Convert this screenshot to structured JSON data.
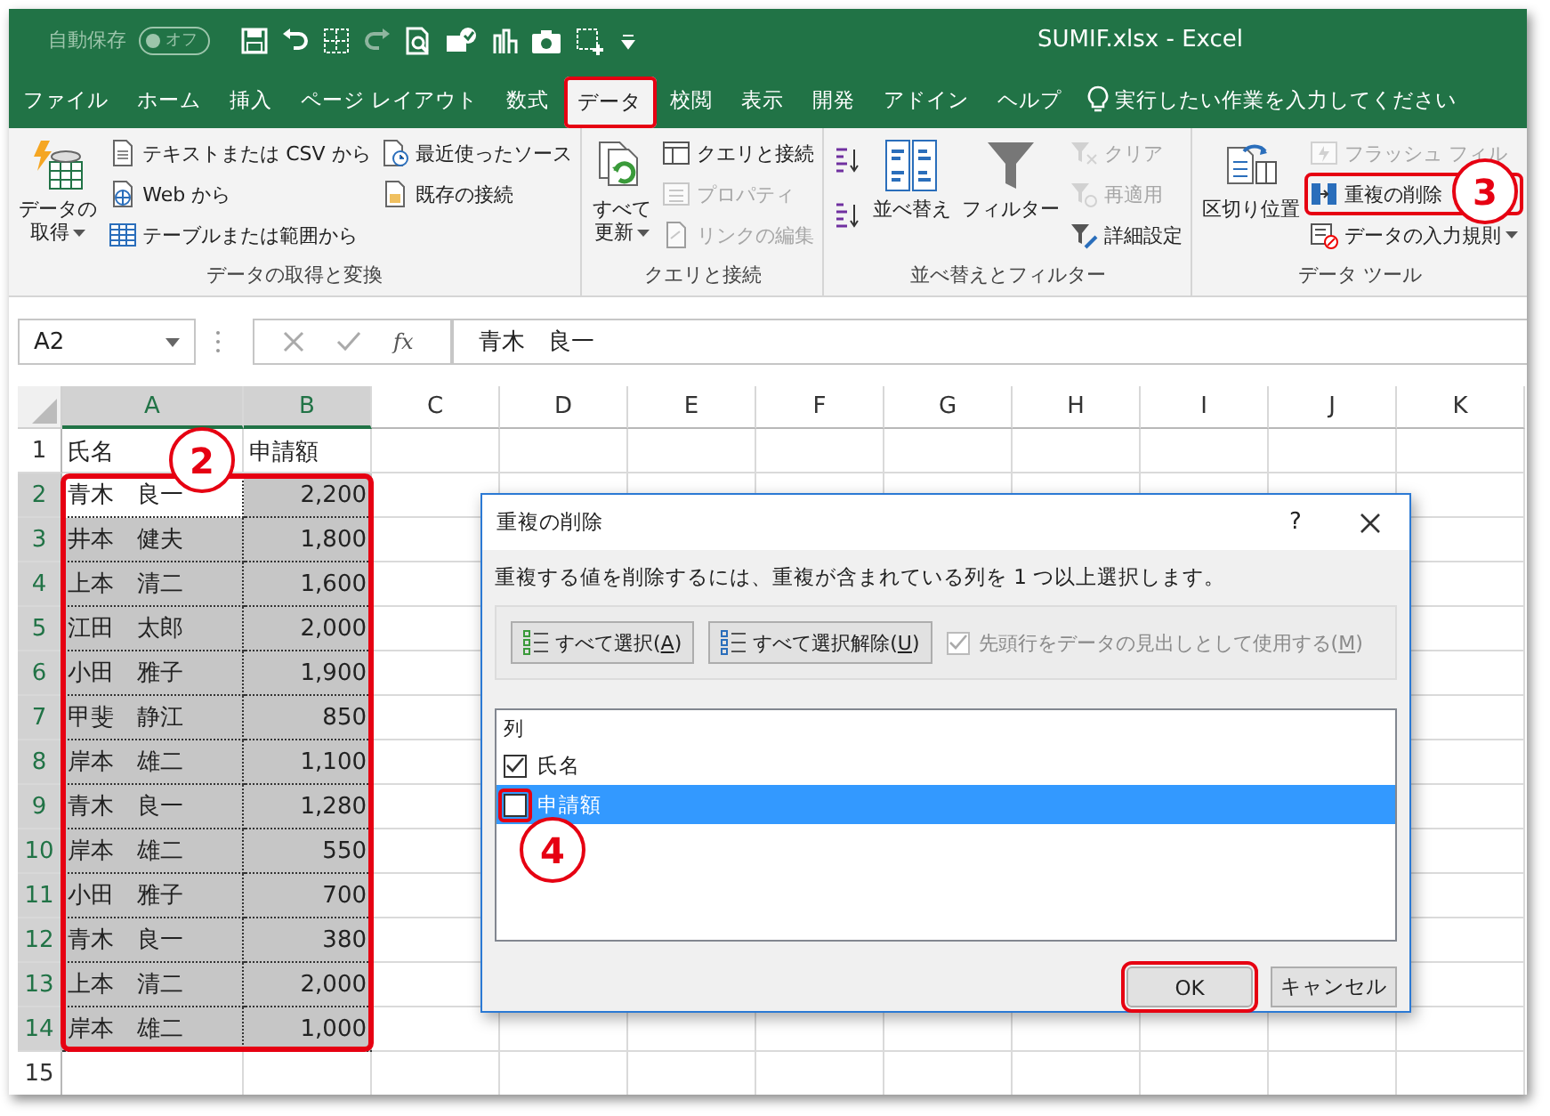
{
  "window": {
    "title": "SUMIF.xlsx - Excel"
  },
  "autosave": {
    "label": "自動保存",
    "state": "オフ",
    "on": false
  },
  "tabs": [
    {
      "label": "ファイル",
      "selected": false,
      "highlighted": false
    },
    {
      "label": "ホーム",
      "selected": false,
      "highlighted": false
    },
    {
      "label": "挿入",
      "selected": false,
      "highlighted": false
    },
    {
      "label": "ページ レイアウト",
      "selected": false,
      "highlighted": false
    },
    {
      "label": "数式",
      "selected": false,
      "highlighted": false
    },
    {
      "label": "データ",
      "selected": true,
      "highlighted": true
    },
    {
      "label": "校閲",
      "selected": false,
      "highlighted": false
    },
    {
      "label": "表示",
      "selected": false,
      "highlighted": false
    },
    {
      "label": "開発",
      "selected": false,
      "highlighted": false
    },
    {
      "label": "アドイン",
      "selected": false,
      "highlighted": false
    },
    {
      "label": "ヘルプ",
      "selected": false,
      "highlighted": false
    }
  ],
  "tell_me": {
    "text": "実行したい作業を入力してください"
  },
  "ribbon": {
    "groups": [
      {
        "label": "データの取得と変換",
        "columns": [
          [
            {
              "kind": "large",
              "label": "データの取得",
              "dropdown": true,
              "disabled": false,
              "highlighted": false
            }
          ],
          [
            {
              "kind": "small",
              "label": "テキストまたは CSV から",
              "dropdown": false,
              "disabled": false,
              "highlighted": false
            },
            {
              "kind": "small",
              "label": "Web から",
              "dropdown": false,
              "disabled": false,
              "highlighted": false
            },
            {
              "kind": "small",
              "label": "テーブルまたは範囲から",
              "dropdown": false,
              "disabled": false,
              "highlighted": false
            }
          ],
          [
            {
              "kind": "small",
              "label": "最近使ったソース",
              "dropdown": false,
              "disabled": false,
              "highlighted": false
            },
            {
              "kind": "small",
              "label": "既存の接続",
              "dropdown": false,
              "disabled": false,
              "highlighted": false
            }
          ]
        ]
      },
      {
        "label": "クエリと接続",
        "columns": [
          [
            {
              "kind": "large",
              "label": "すべて更新",
              "dropdown": true,
              "disabled": false,
              "highlighted": false
            }
          ],
          [
            {
              "kind": "small",
              "label": "クエリと接続",
              "dropdown": false,
              "disabled": false,
              "highlighted": false
            },
            {
              "kind": "small",
              "label": "プロパティ",
              "dropdown": false,
              "disabled": true,
              "highlighted": false
            },
            {
              "kind": "small",
              "label": "リンクの編集",
              "dropdown": false,
              "disabled": true,
              "highlighted": false
            }
          ]
        ]
      },
      {
        "label": "並べ替えとフィルター",
        "columns": [
          [
            {
              "kind": "icon",
              "highlighted": false
            },
            {
              "kind": "icon",
              "highlighted": false
            }
          ],
          [
            {
              "kind": "large",
              "label": "並べ替え",
              "dropdown": false,
              "disabled": false,
              "highlighted": false
            }
          ],
          [
            {
              "kind": "large",
              "label": "フィルター",
              "dropdown": false,
              "disabled": false,
              "highlighted": false
            }
          ],
          [
            {
              "kind": "small",
              "label": "クリア",
              "dropdown": false,
              "disabled": true,
              "highlighted": false
            },
            {
              "kind": "small",
              "label": "再適用",
              "dropdown": false,
              "disabled": true,
              "highlighted": false
            },
            {
              "kind": "small",
              "label": "詳細設定",
              "dropdown": false,
              "disabled": false,
              "highlighted": false
            }
          ]
        ]
      },
      {
        "label": "データ ツール",
        "columns": [
          [
            {
              "kind": "large",
              "label": "区切り位置",
              "dropdown": false,
              "disabled": false,
              "highlighted": false
            }
          ],
          [
            {
              "kind": "small",
              "label": "フラッシュ フィル",
              "dropdown": false,
              "disabled": true,
              "highlighted": false
            },
            {
              "kind": "small",
              "label": "重複の削除",
              "dropdown": false,
              "disabled": false,
              "highlighted": true
            },
            {
              "kind": "small",
              "label": "データの入力規則",
              "dropdown": true,
              "disabled": false,
              "highlighted": false
            }
          ]
        ]
      }
    ]
  },
  "formula_bar": {
    "name_box": "A2",
    "function_label": "fx",
    "value": "青木　良一"
  },
  "grid": {
    "range_highlighted": true,
    "columns": [
      {
        "label": "A",
        "selected": true
      },
      {
        "label": "B",
        "selected": true
      },
      {
        "label": "C",
        "selected": false
      },
      {
        "label": "D",
        "selected": false
      },
      {
        "label": "E",
        "selected": false
      },
      {
        "label": "F",
        "selected": false
      },
      {
        "label": "G",
        "selected": false
      },
      {
        "label": "H",
        "selected": false
      },
      {
        "label": "I",
        "selected": false
      },
      {
        "label": "J",
        "selected": false
      },
      {
        "label": "K",
        "selected": false
      }
    ],
    "rows": [
      {
        "num": "1",
        "selected": false,
        "cells": [
          {
            "text": "氏名",
            "kind": "text",
            "active": false
          },
          {
            "text": "申請額",
            "kind": "text",
            "active": false
          }
        ]
      },
      {
        "num": "2",
        "selected": true,
        "cells": [
          {
            "text": "青木　良一",
            "kind": "text",
            "active": true
          },
          {
            "text": "2,200",
            "kind": "number",
            "active": false
          }
        ]
      },
      {
        "num": "3",
        "selected": true,
        "cells": [
          {
            "text": "井本　健夫",
            "kind": "text",
            "active": false
          },
          {
            "text": "1,800",
            "kind": "number",
            "active": false
          }
        ]
      },
      {
        "num": "4",
        "selected": true,
        "cells": [
          {
            "text": "上本　清二",
            "kind": "text",
            "active": false
          },
          {
            "text": "1,600",
            "kind": "number",
            "active": false
          }
        ]
      },
      {
        "num": "5",
        "selected": true,
        "cells": [
          {
            "text": "江田　太郎",
            "kind": "text",
            "active": false
          },
          {
            "text": "2,000",
            "kind": "number",
            "active": false
          }
        ]
      },
      {
        "num": "6",
        "selected": true,
        "cells": [
          {
            "text": "小田　雅子",
            "kind": "text",
            "active": false
          },
          {
            "text": "1,900",
            "kind": "number",
            "active": false
          }
        ]
      },
      {
        "num": "7",
        "selected": true,
        "cells": [
          {
            "text": "甲斐　静江",
            "kind": "text",
            "active": false
          },
          {
            "text": "850",
            "kind": "number",
            "active": false
          }
        ]
      },
      {
        "num": "8",
        "selected": true,
        "cells": [
          {
            "text": "岸本　雄二",
            "kind": "text",
            "active": false
          },
          {
            "text": "1,100",
            "kind": "number",
            "active": false
          }
        ]
      },
      {
        "num": "9",
        "selected": true,
        "cells": [
          {
            "text": "青木　良一",
            "kind": "text",
            "active": false
          },
          {
            "text": "1,280",
            "kind": "number",
            "active": false
          }
        ]
      },
      {
        "num": "10",
        "selected": true,
        "cells": [
          {
            "text": "岸本　雄二",
            "kind": "text",
            "active": false
          },
          {
            "text": "550",
            "kind": "number",
            "active": false
          }
        ]
      },
      {
        "num": "11",
        "selected": true,
        "cells": [
          {
            "text": "小田　雅子",
            "kind": "text",
            "active": false
          },
          {
            "text": "700",
            "kind": "number",
            "active": false
          }
        ]
      },
      {
        "num": "12",
        "selected": true,
        "cells": [
          {
            "text": "青木　良一",
            "kind": "text",
            "active": false
          },
          {
            "text": "380",
            "kind": "number",
            "active": false
          }
        ]
      },
      {
        "num": "13",
        "selected": true,
        "cells": [
          {
            "text": "上本　清二",
            "kind": "text",
            "active": false
          },
          {
            "text": "2,000",
            "kind": "number",
            "active": false
          }
        ]
      },
      {
        "num": "14",
        "selected": true,
        "cells": [
          {
            "text": "岸本　雄二",
            "kind": "text",
            "active": false
          },
          {
            "text": "1,000",
            "kind": "number",
            "active": false
          }
        ]
      },
      {
        "num": "15",
        "selected": false
      }
    ]
  },
  "dialog": {
    "title": "重複の削除",
    "help": "?",
    "description": "重複する値を削除するには、重複が含まれている列を 1 つ以上選択します。",
    "buttons": [
      {
        "before": "すべて選択(",
        "key": "A",
        "after": ")"
      },
      {
        "before": "すべて選択解除(",
        "key": "U",
        "after": ")"
      }
    ],
    "header_option": {
      "before": "先頭行をデータの見出しとして使用する(",
      "key": "M",
      "after": ")",
      "checked": true,
      "disabled": true
    },
    "list_header": "列",
    "columns": [
      {
        "label": "氏名",
        "checked": true,
        "selected": false,
        "highlighted": false
      },
      {
        "label": "申請額",
        "checked": false,
        "selected": true,
        "highlighted": true
      }
    ],
    "footer": [
      {
        "label": "OK",
        "highlighted": true
      },
      {
        "label": "キャンセル",
        "highlighted": false
      }
    ]
  },
  "annotations": [
    {
      "number": "2"
    },
    {
      "number": "3"
    },
    {
      "number": "4"
    }
  ]
}
